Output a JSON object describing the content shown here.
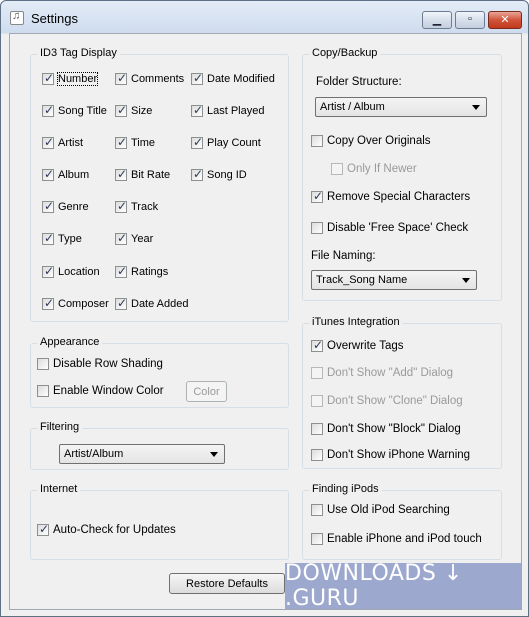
{
  "window": {
    "title": "Settings"
  },
  "id3": {
    "legend": "ID3 Tag Display",
    "col1": [
      "Number",
      "Song Title",
      "Artist",
      "Album",
      "Genre",
      "Type",
      "Location",
      "Composer"
    ],
    "col2": [
      "Comments",
      "Size",
      "Time",
      "Bit Rate",
      "Track",
      "Year",
      "Ratings",
      "Date Added"
    ],
    "col3": [
      "Date Modified",
      "Last Played",
      "Play Count",
      "Song ID"
    ]
  },
  "appearance": {
    "legend": "Appearance",
    "disable_row_shading": "Disable Row Shading",
    "enable_window_color": "Enable Window Color",
    "color_button": "Color"
  },
  "filtering": {
    "legend": "Filtering",
    "selected": "Artist/Album"
  },
  "internet": {
    "legend": "Internet",
    "auto_check": "Auto-Check for Updates"
  },
  "copy_backup": {
    "legend": "Copy/Backup",
    "folder_structure_label": "Folder Structure:",
    "folder_structure_value": "Artist / Album",
    "copy_over_originals": "Copy Over Originals",
    "only_if_newer": "Only If Newer",
    "remove_special": "Remove Special Characters",
    "disable_free_space": "Disable 'Free Space' Check",
    "file_naming_label": "File Naming:",
    "file_naming_value": "Track_Song Name"
  },
  "itunes": {
    "legend": "iTunes Integration",
    "overwrite_tags": "Overwrite Tags",
    "dont_show_add": "Don't Show \"Add\" Dialog",
    "dont_show_clone": "Don't Show \"Clone\" Dialog",
    "dont_show_block": "Don't Show \"Block\" Dialog",
    "dont_show_iphone": "Don't Show iPhone Warning"
  },
  "finding_ipods": {
    "legend": "Finding iPods",
    "use_old_search": "Use Old iPod Searching",
    "enable_iphone_touch": "Enable iPhone and iPod touch"
  },
  "buttons": {
    "restore_defaults": "Restore Defaults"
  },
  "watermark": {
    "text": "DOWNLOADS ↓ .GURU"
  }
}
